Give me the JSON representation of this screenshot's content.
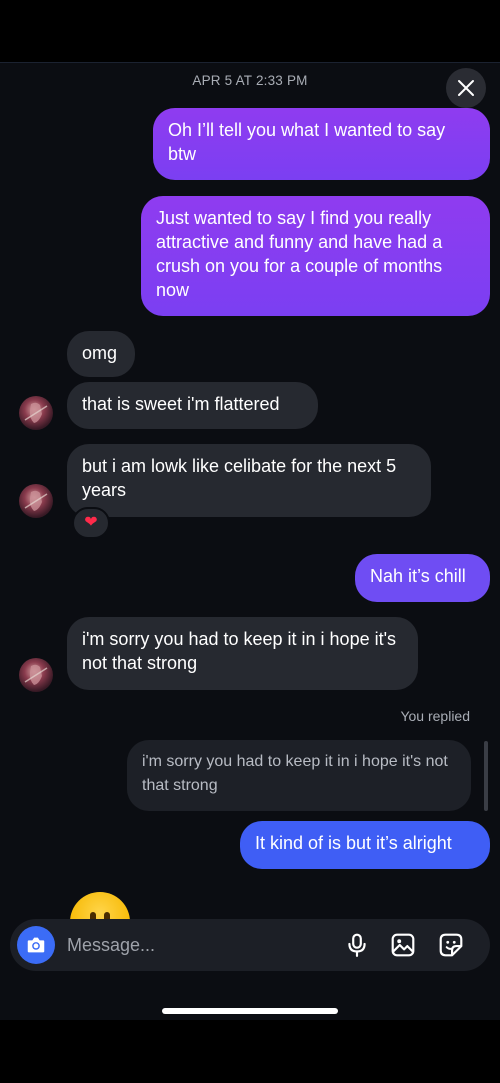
{
  "header": {
    "timestamp": "APR 5 AT 2:33 PM",
    "close_icon": "close-icon"
  },
  "messages": [
    {
      "id": "m1",
      "direction": "outgoing",
      "text": "Oh I’ll tell you what I wanted to say btw"
    },
    {
      "id": "m2",
      "direction": "outgoing",
      "text": "Just wanted to say I find you really attractive and funny and have had a crush on you for a couple of months now"
    },
    {
      "id": "m3",
      "direction": "incoming",
      "text": "omg"
    },
    {
      "id": "m4",
      "direction": "incoming",
      "text": "that is sweet i'm flattered"
    },
    {
      "id": "m5",
      "direction": "incoming",
      "text": "but i am lowk like celibate for the next 5 years",
      "reaction": "❤"
    },
    {
      "id": "m6",
      "direction": "outgoing",
      "text": "Nah it’s chill"
    },
    {
      "id": "m7",
      "direction": "incoming",
      "text": "i'm sorry you had to keep it in i hope it's not that strong"
    },
    {
      "id": "m8",
      "direction": "outgoing",
      "replied_label": "You replied",
      "quote": "i'm sorry you had to keep it in i hope it's not that strong",
      "text": "It kind of is but it’s alright"
    }
  ],
  "composer": {
    "placeholder": "Message...",
    "icons": [
      "camera-icon",
      "microphone-icon",
      "gallery-icon",
      "sticker-icon"
    ]
  },
  "colors": {
    "background": "#0b0d12",
    "incoming_bubble": "#262930",
    "outgoing_purple": "#8f3cf0",
    "outgoing_violet": "#6f4df3",
    "outgoing_blue": "#3f5ef5",
    "camera_button": "#3b6cf6"
  }
}
